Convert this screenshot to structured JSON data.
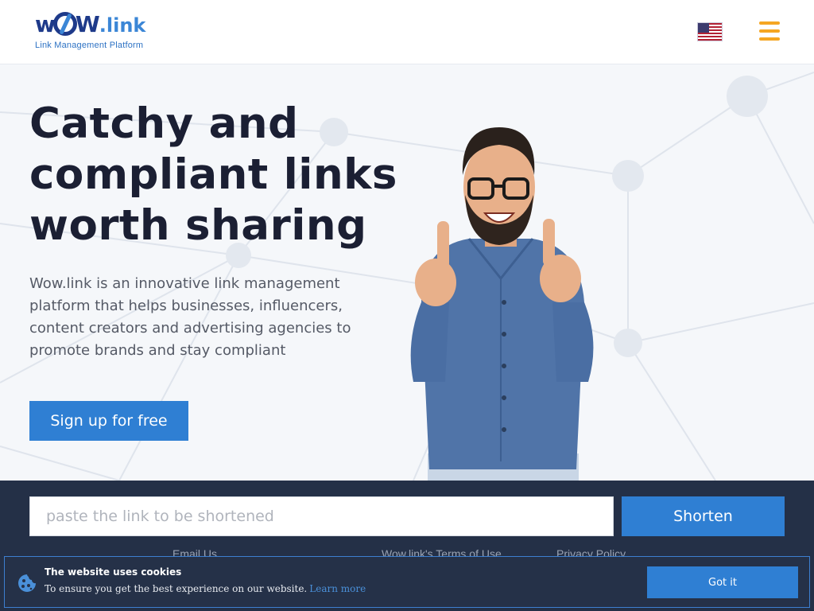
{
  "header": {
    "logo_word_a": "w",
    "logo_word_b": "W",
    "logo_word_c": ".link",
    "logo_tagline": "Link Management Platform",
    "language_flag": "us-flag-icon",
    "menu_icon": "hamburger-menu-icon"
  },
  "hero": {
    "headline_line1": "Catchy and",
    "headline_line2": "compliant links",
    "headline_line3": "worth sharing",
    "description": "Wow.link is an innovative link management platform that helps businesses, influencers, content creators and advertising agencies to promote brands and stay compliant",
    "signup_label": "Sign up for free"
  },
  "shortener": {
    "placeholder": "paste the link to be shortened",
    "button_label": "Shorten"
  },
  "footer_links": {
    "link_a": "Email Us",
    "link_b": "Wow.link's Terms of Use",
    "link_c": "Privacy Policy"
  },
  "cookie_banner": {
    "title": "The website uses cookies",
    "text": "To ensure you get the best experience on our website.",
    "learn_more": "Learn more",
    "accept_label": "Got it"
  },
  "colors": {
    "brand_blue": "#2f7fd3",
    "dark_navy": "#243047",
    "menu_orange": "#f5a623",
    "headline": "#1b1f33"
  }
}
